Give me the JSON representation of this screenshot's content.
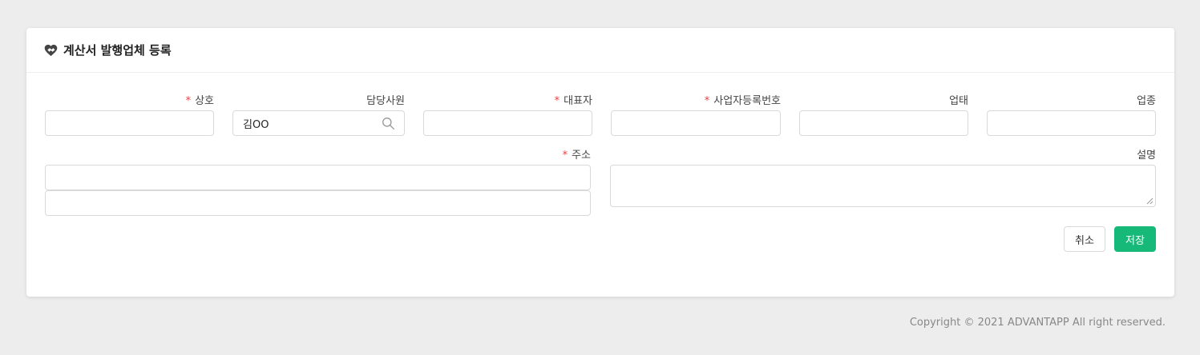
{
  "header": {
    "title": "계산서 발행업체 등록",
    "icon": "heart-handshake-icon"
  },
  "form": {
    "required_mark": "*",
    "company_name": {
      "label": "상호",
      "required": true,
      "value": ""
    },
    "manager": {
      "label": "담당사원",
      "required": false,
      "value": "김OO",
      "icon": "search-icon"
    },
    "representative": {
      "label": "대표자",
      "required": true,
      "value": ""
    },
    "business_number": {
      "label": "사업자등록번호",
      "required": true,
      "value": ""
    },
    "business_type": {
      "label": "업태",
      "required": false,
      "value": ""
    },
    "business_item": {
      "label": "업종",
      "required": false,
      "value": ""
    },
    "address": {
      "label": "주소",
      "required": true,
      "line1": "",
      "line2": ""
    },
    "description": {
      "label": "설명",
      "required": false,
      "value": ""
    }
  },
  "actions": {
    "cancel_label": "취소",
    "save_label": "저장"
  },
  "colors": {
    "accent": "#17b978",
    "required": "#e84141",
    "background": "#ededed"
  },
  "footer": {
    "copyright": "Copyright © 2021 ADVANTAPP All right reserved."
  }
}
